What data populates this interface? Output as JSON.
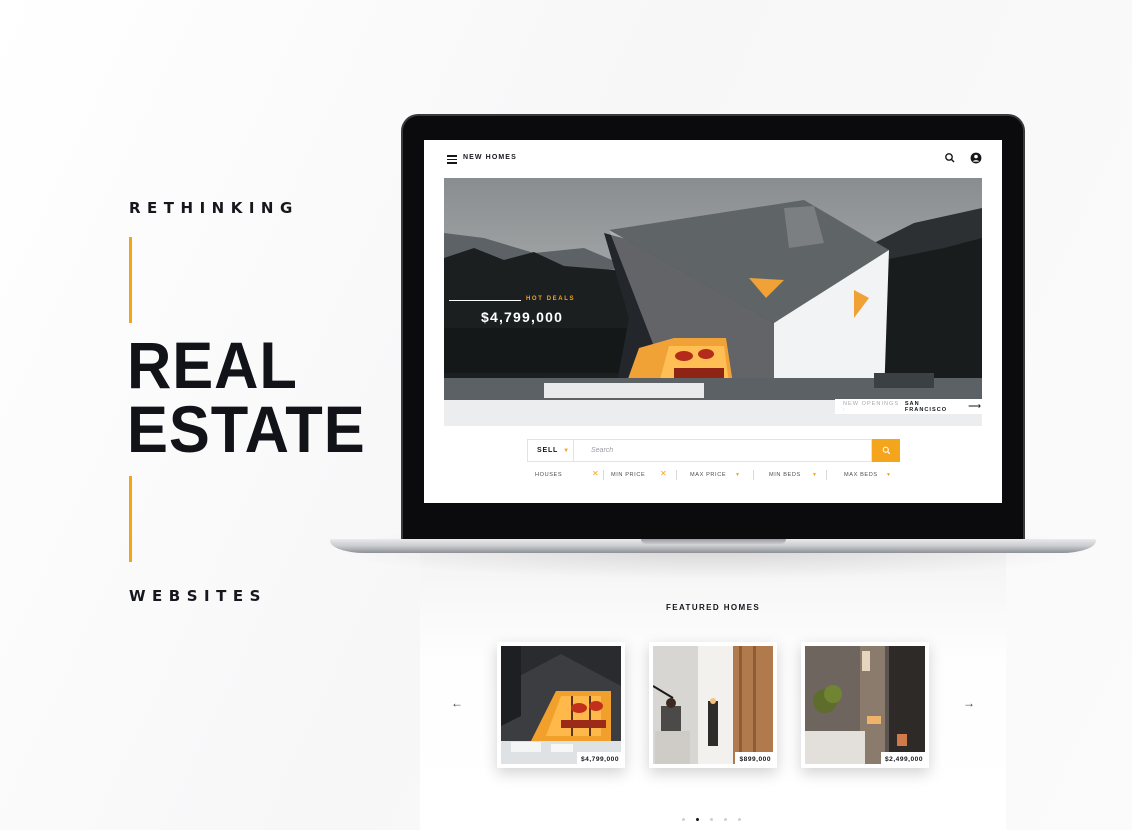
{
  "poster": {
    "kicker_top": "RETHINKING",
    "headline_line1": "REAL",
    "headline_line2": "ESTATE",
    "kicker_bottom": "WEBSITES",
    "accent_color": "#f2a515"
  },
  "site": {
    "brand": "NEW HOMES",
    "icons": {
      "menu": "hamburger-icon",
      "search": "search-icon",
      "account": "user-icon"
    },
    "hero": {
      "label": "HOT DEALS",
      "price": "$4,799,000",
      "openings_prefix": "NEW OPENINGS :",
      "openings_city": "SAN FRANCISCO",
      "openings_arrow": "⟶"
    },
    "search": {
      "mode": "SELL",
      "placeholder": "Search",
      "button_icon": "search-icon"
    },
    "filters": [
      {
        "label": "HOUSES",
        "control": "✕"
      },
      {
        "label": "MIN PRICE",
        "control": "✕"
      },
      {
        "label": "MAX PRICE",
        "control": "▼"
      },
      {
        "label": "MIN BEDS",
        "control": "▼"
      },
      {
        "label": "MAX BEDS",
        "control": "▼"
      }
    ]
  },
  "featured": {
    "title": "FEATURED HOMES",
    "prev": "←",
    "next": "→",
    "cards": [
      {
        "price": "$4,799,000"
      },
      {
        "price": "$899,000"
      },
      {
        "price": "$2,499,000"
      }
    ],
    "dots_total": 5,
    "dots_active": 2
  }
}
